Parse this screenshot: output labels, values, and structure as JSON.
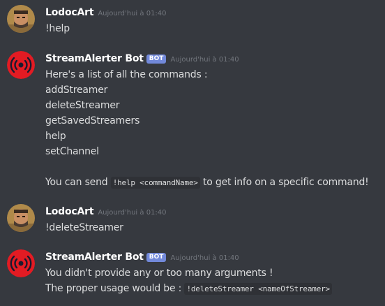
{
  "messages": [
    {
      "username": "LodocArt",
      "timestamp": "Aujourd'hui à 01:40",
      "avatar": "user-portrait",
      "lines": [
        "!help"
      ]
    },
    {
      "username": "StreamAlerter Bot",
      "bot_tag": "BOT",
      "timestamp": "Aujourd'hui à 01:40",
      "avatar": "broadcast-icon",
      "lines": [
        "Here's a list of all the commands :",
        "addStreamer",
        "deleteStreamer",
        "getSavedStreamers",
        "help",
        "setChannel",
        "",
        {
          "prefix": "You can send ",
          "code": "!help <commandName>",
          "suffix": " to get info on a specific command!"
        }
      ]
    },
    {
      "username": "LodocArt",
      "timestamp": "Aujourd'hui à 01:40",
      "avatar": "user-portrait",
      "lines": [
        "!deleteStreamer"
      ]
    },
    {
      "username": "StreamAlerter Bot",
      "bot_tag": "BOT",
      "timestamp": "Aujourd'hui à 01:40",
      "avatar": "broadcast-icon",
      "lines": [
        "You didn't provide any or too many arguments !",
        {
          "prefix": "The proper usage would be : ",
          "code": "!deleteStreamer <nameOfStreamer>",
          "suffix": ""
        }
      ]
    }
  ],
  "colors": {
    "background": "#36393f",
    "username": "#ffffff",
    "text": "#dcddde",
    "timestamp": "#72767d",
    "bot_tag": "#7289da",
    "code_bg": "#2f3136",
    "bot_avatar": "#e31b23"
  }
}
